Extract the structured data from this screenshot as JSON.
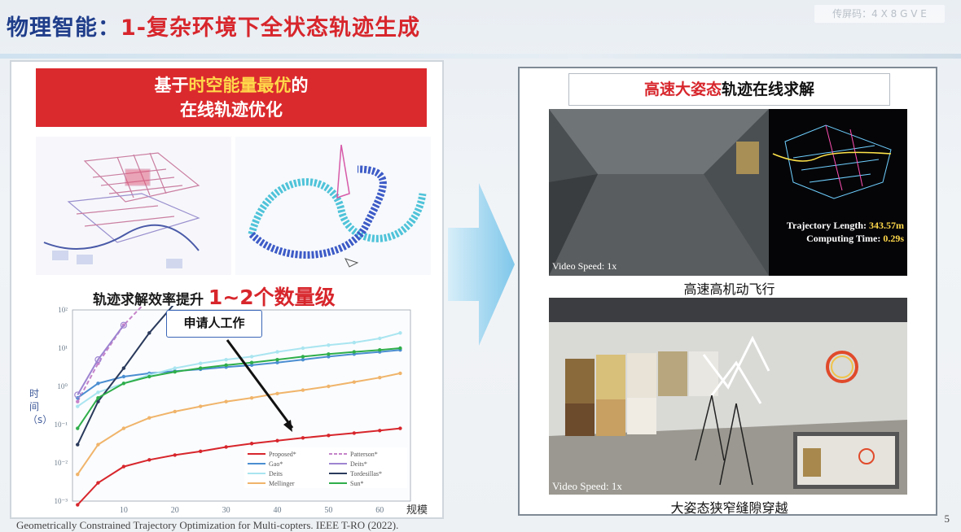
{
  "slide": {
    "title_prefix": "物理智能：",
    "title_number": "1",
    "title_main": "-复杂环境下全状态轨迹生成",
    "share_code": "传屏码：4 X 8 G V E",
    "page_number": "5",
    "citation": "Geometrically Constrained Trajectory Optimization for Multi-copters. IEEE T-RO (2022)."
  },
  "left": {
    "banner_line1_a": "基于",
    "banner_line1_b": "时空能量最优",
    "banner_line1_c": "的",
    "banner_line2": "在线轨迹优化",
    "efficiency_a": "轨迹求解效率提升 ",
    "efficiency_b": "1~2个数量级",
    "callout": "申请人工作",
    "y_axis_label": "时间（s）",
    "x_axis_unit": "规模"
  },
  "right": {
    "title_red": "高速大姿态",
    "title_black": "轨迹在线求解",
    "caption_top": "高速高机动飞行",
    "caption_bottom": "大姿态狭窄缝隙穿越",
    "video_speed_top": "Video Speed: 1x",
    "video_speed_bottom": "Video Speed: 1x",
    "traj_length_label": "Trajectory Length: ",
    "traj_length_value": "343.57m",
    "compute_time_label": "Computing Time: ",
    "compute_time_value": "0.29s"
  },
  "chart_data": {
    "type": "line",
    "x_ticks": [
      "10",
      "20",
      "30",
      "40",
      "50",
      "60"
    ],
    "y_ticks": [
      "10⁻³",
      "10⁻²",
      "10⁻¹",
      "10⁰",
      "10¹",
      "10²"
    ],
    "x": [
      1,
      5,
      10,
      15,
      20,
      25,
      30,
      35,
      40,
      45,
      50,
      55,
      60,
      64
    ],
    "ylog": true,
    "series": [
      {
        "name": "Proposed*",
        "color": "#d7262c",
        "values": [
          0.0008,
          0.003,
          0.008,
          0.012,
          0.016,
          0.02,
          0.026,
          0.032,
          0.038,
          0.045,
          0.052,
          0.06,
          0.07,
          0.08
        ]
      },
      {
        "name": "Patterson*",
        "color": "#c583c9",
        "dashed": true,
        "values": [
          0.4,
          4,
          40,
          200,
          null,
          null,
          null,
          null,
          null,
          null,
          null,
          null,
          null,
          null
        ]
      },
      {
        "name": "Gao*",
        "color": "#4b8ed1",
        "values": [
          0.5,
          1.2,
          1.8,
          2.2,
          2.5,
          2.8,
          3.2,
          3.6,
          4.2,
          5,
          6,
          7,
          8,
          9
        ]
      },
      {
        "name": "Deits*",
        "color": "#9d84d1",
        "marker": "circle",
        "values": [
          0.6,
          5,
          40,
          null,
          null,
          null,
          null,
          null,
          null,
          null,
          null,
          null,
          null,
          null
        ]
      },
      {
        "name": "Deits",
        "color": "#a9e5f0",
        "values": [
          0.3,
          0.7,
          1.2,
          2,
          3,
          4,
          5,
          6,
          8,
          10,
          12,
          14,
          18,
          25
        ]
      },
      {
        "name": "Tordesillas*",
        "color": "#2a3a5c",
        "values": [
          0.03,
          0.4,
          3,
          25,
          150,
          null,
          null,
          null,
          null,
          null,
          null,
          null,
          null,
          null
        ]
      },
      {
        "name": "Mellinger",
        "color": "#f0b46a",
        "values": [
          0.005,
          0.03,
          0.08,
          0.15,
          0.22,
          0.3,
          0.4,
          0.5,
          0.65,
          0.8,
          1,
          1.3,
          1.7,
          2.2
        ]
      },
      {
        "name": "Sun*",
        "color": "#2fae4a",
        "values": [
          0.08,
          0.5,
          1.2,
          1.8,
          2.4,
          3,
          3.6,
          4.2,
          5,
          6,
          7,
          8,
          9,
          10
        ]
      }
    ]
  }
}
